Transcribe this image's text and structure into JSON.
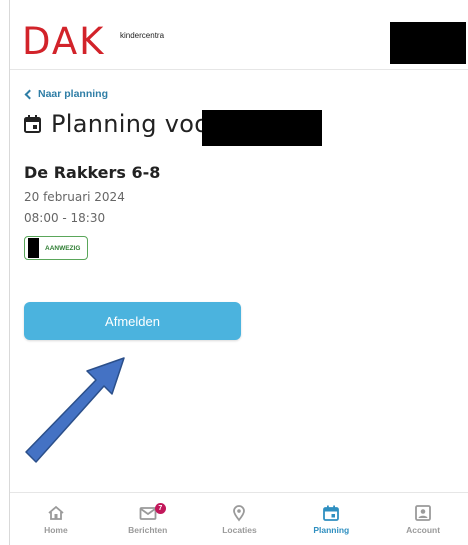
{
  "header": {
    "logo_text": "DAK",
    "logo_sub": "kindercentra"
  },
  "back_link": {
    "label": "Naar planning"
  },
  "page": {
    "title": "Planning voor"
  },
  "booking": {
    "group": "De Rakkers 6-8",
    "date": "20 februari 2024",
    "time": "08:00 - 18:30",
    "status": "AANWEZIG"
  },
  "actions": {
    "afmelden_label": "Afmelden"
  },
  "nav": {
    "items": [
      {
        "label": "Home",
        "icon": "home-icon"
      },
      {
        "label": "Berichten",
        "icon": "mail-icon",
        "badge": "7"
      },
      {
        "label": "Locaties",
        "icon": "location-pin-icon"
      },
      {
        "label": "Planning",
        "icon": "calendar-icon",
        "active": true
      },
      {
        "label": "Account",
        "icon": "account-icon"
      }
    ]
  },
  "colors": {
    "brand_red": "#d2232a",
    "accent_blue": "#4bb3de",
    "link_blue": "#2f7ea6",
    "status_green": "#2e7d32",
    "annotation_arrow": "#4472c4"
  }
}
